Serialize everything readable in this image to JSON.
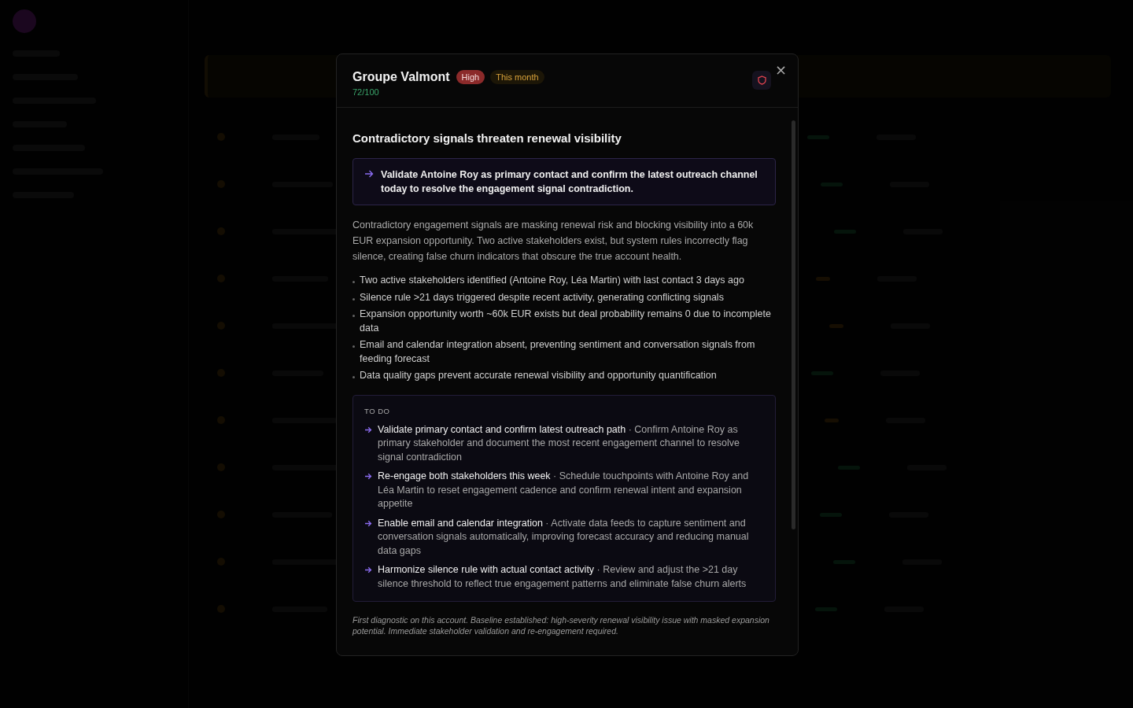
{
  "modal": {
    "title": "Groupe Valmont",
    "badges": [
      {
        "label": "High",
        "kind": "severity"
      },
      {
        "label": "This month",
        "kind": "timing"
      }
    ],
    "score": "72/100",
    "close": "×",
    "heading": "Contradictory signals threaten renewal visibility",
    "callout": "Validate Antoine Roy as primary contact and confirm the latest outreach channel today to resolve the engagement signal contradiction.",
    "summary": "Contradictory engagement signals are masking renewal risk and blocking visibility into a 60k EUR expansion opportunity. Two active stakeholders exist, but system rules incorrectly flag silence, creating false churn indicators that obscure the true account health.",
    "findings": [
      "Two active stakeholders identified (Antoine Roy, Léa Martin) with last contact 3 days ago",
      "Silence rule >21 days triggered despite recent activity, generating conflicting signals",
      "Expansion opportunity worth ~60k EUR exists but deal probability remains 0 due to incomplete data",
      "Email and calendar integration absent, preventing sentiment and conversation signals from feeding forecast",
      "Data quality gaps prevent accurate renewal visibility and opportunity quantification"
    ],
    "todo": {
      "title": "TO DO",
      "items": [
        {
          "action": "Validate primary contact and confirm latest outreach path",
          "detail": "· Confirm Antoine Roy as primary stakeholder and document the most recent engagement channel to resolve signal contradiction"
        },
        {
          "action": "Re-engage both stakeholders this week",
          "detail": "· Schedule touchpoints with Antoine Roy and Léa Martin to reset engagement cadence and confirm renewal intent and expansion appetite"
        },
        {
          "action": "Enable email and calendar integration",
          "detail": "· Activate data feeds to capture sentiment and conversation signals automatically, improving forecast accuracy and reducing manual data gaps"
        },
        {
          "action": "Harmonize silence rule with actual contact activity",
          "detail": "· Review and adjust the >21 day silence threshold to reflect true engagement patterns and eliminate false churn alerts"
        }
      ]
    },
    "note": "First diagnostic on this account. Baseline established: high-severity renewal visibility issue with masked expansion potential. Immediate stakeholder validation and re-engagement required."
  }
}
